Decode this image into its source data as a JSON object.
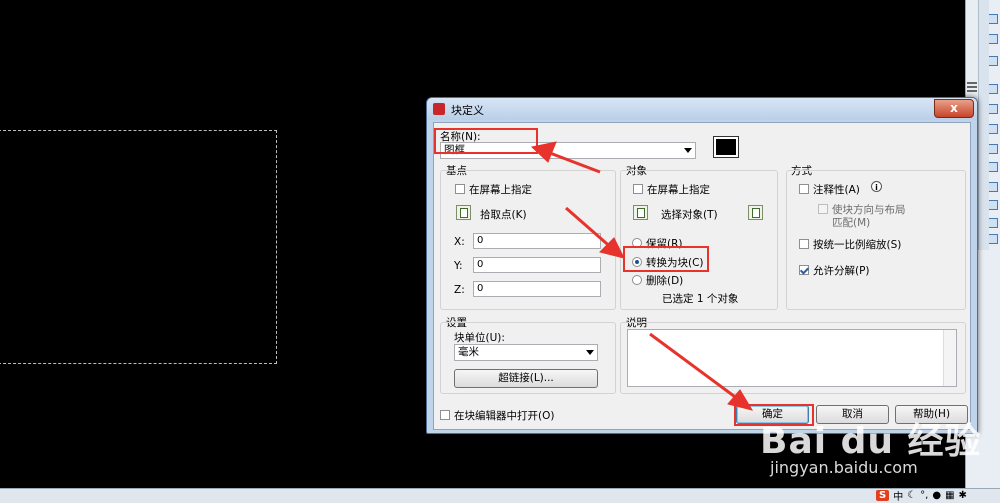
{
  "dialog": {
    "title": "块定义",
    "close_label": "x",
    "name_label": "名称(N):",
    "name_value": "图框",
    "basepoint": {
      "group_label": "基点",
      "specify_on_screen": "在屏幕上指定",
      "pick_point": "拾取点(K)",
      "x_label": "X:",
      "x_value": "0",
      "y_label": "Y:",
      "y_value": "0",
      "z_label": "Z:",
      "z_value": "0"
    },
    "objects": {
      "group_label": "对象",
      "specify_on_screen": "在屏幕上指定",
      "select_objects": "选择对象(T)",
      "retain": "保留(R)",
      "convert_to_block": "转换为块(C)",
      "delete": "删除(D)",
      "selected_count": "已选定 1 个对象"
    },
    "behavior": {
      "group_label": "方式",
      "annotative": "注释性(A)",
      "match_orientation": "使块方向与布局",
      "match_orientation_2": "匹配(M)",
      "scale_uniformly": "按统一比例缩放(S)",
      "allow_exploding": "允许分解(P)"
    },
    "settings": {
      "group_label": "设置",
      "block_unit_label": "块单位(U):",
      "block_unit_value": "毫米",
      "hyperlink": "超链接(L)..."
    },
    "description": {
      "group_label": "说明"
    },
    "open_in_editor": "在块编辑器中打开(O)",
    "ok": "确定",
    "cancel": "取消",
    "help": "帮助(H)"
  },
  "system": {
    "ime_label": "中"
  },
  "watermark": {
    "logo": "Bai du 经验",
    "url": "jingyan.baidu.com"
  },
  "colors": {
    "annotation_red": "#e8322c",
    "dialog_frame": "#bfd3ea",
    "canvas": "#000000"
  }
}
